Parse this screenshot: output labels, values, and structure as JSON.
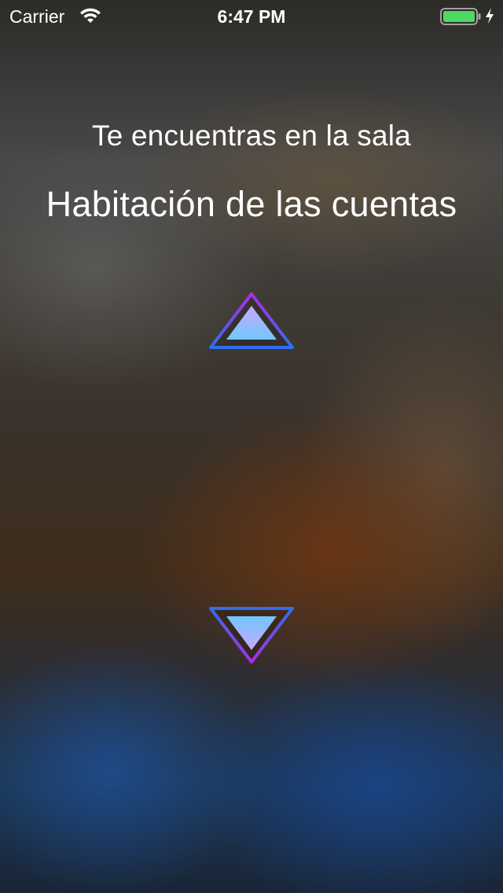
{
  "status_bar": {
    "carrier": "Carrier",
    "time": "6:47 PM",
    "wifi_icon": "wifi-icon",
    "battery_icon": "battery-full-icon",
    "charging_icon": "charging-bolt-icon",
    "battery_color": "#4cd964"
  },
  "room": {
    "subtitle": "Te encuentras en la sala",
    "name": "Habitación de las cuentas"
  },
  "navigation": {
    "up_icon": "triangle-up-icon",
    "down_icon": "triangle-down-icon",
    "outline_gradient": [
      "#b02ce0",
      "#2f6ef0"
    ],
    "fill_gradient": [
      "#c9a8ff",
      "#6fc8ff"
    ]
  }
}
